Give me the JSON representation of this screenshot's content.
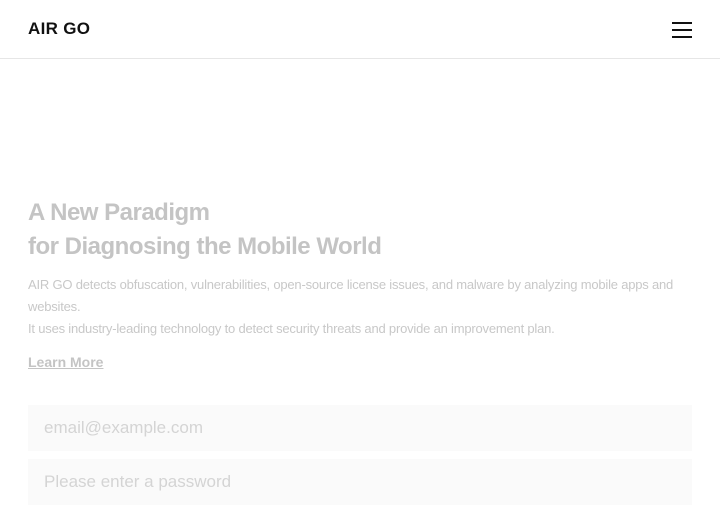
{
  "header": {
    "logo": "AIR GO",
    "menu_icon": "hamburger-menu-icon"
  },
  "hero": {
    "headline_line1": "A New Paradigm",
    "headline_line2": "for Diagnosing the Mobile World",
    "description_line1": "AIR GO detects obfuscation, vulnerabilities, open-source license issues, and malware by analyzing mobile apps and websites.",
    "description_line2": "It uses industry-leading technology to detect security threats and provide an improvement plan.",
    "learn_more": "Learn More"
  },
  "form": {
    "email_placeholder": "email@example.com",
    "password_placeholder": "Please enter a password"
  }
}
